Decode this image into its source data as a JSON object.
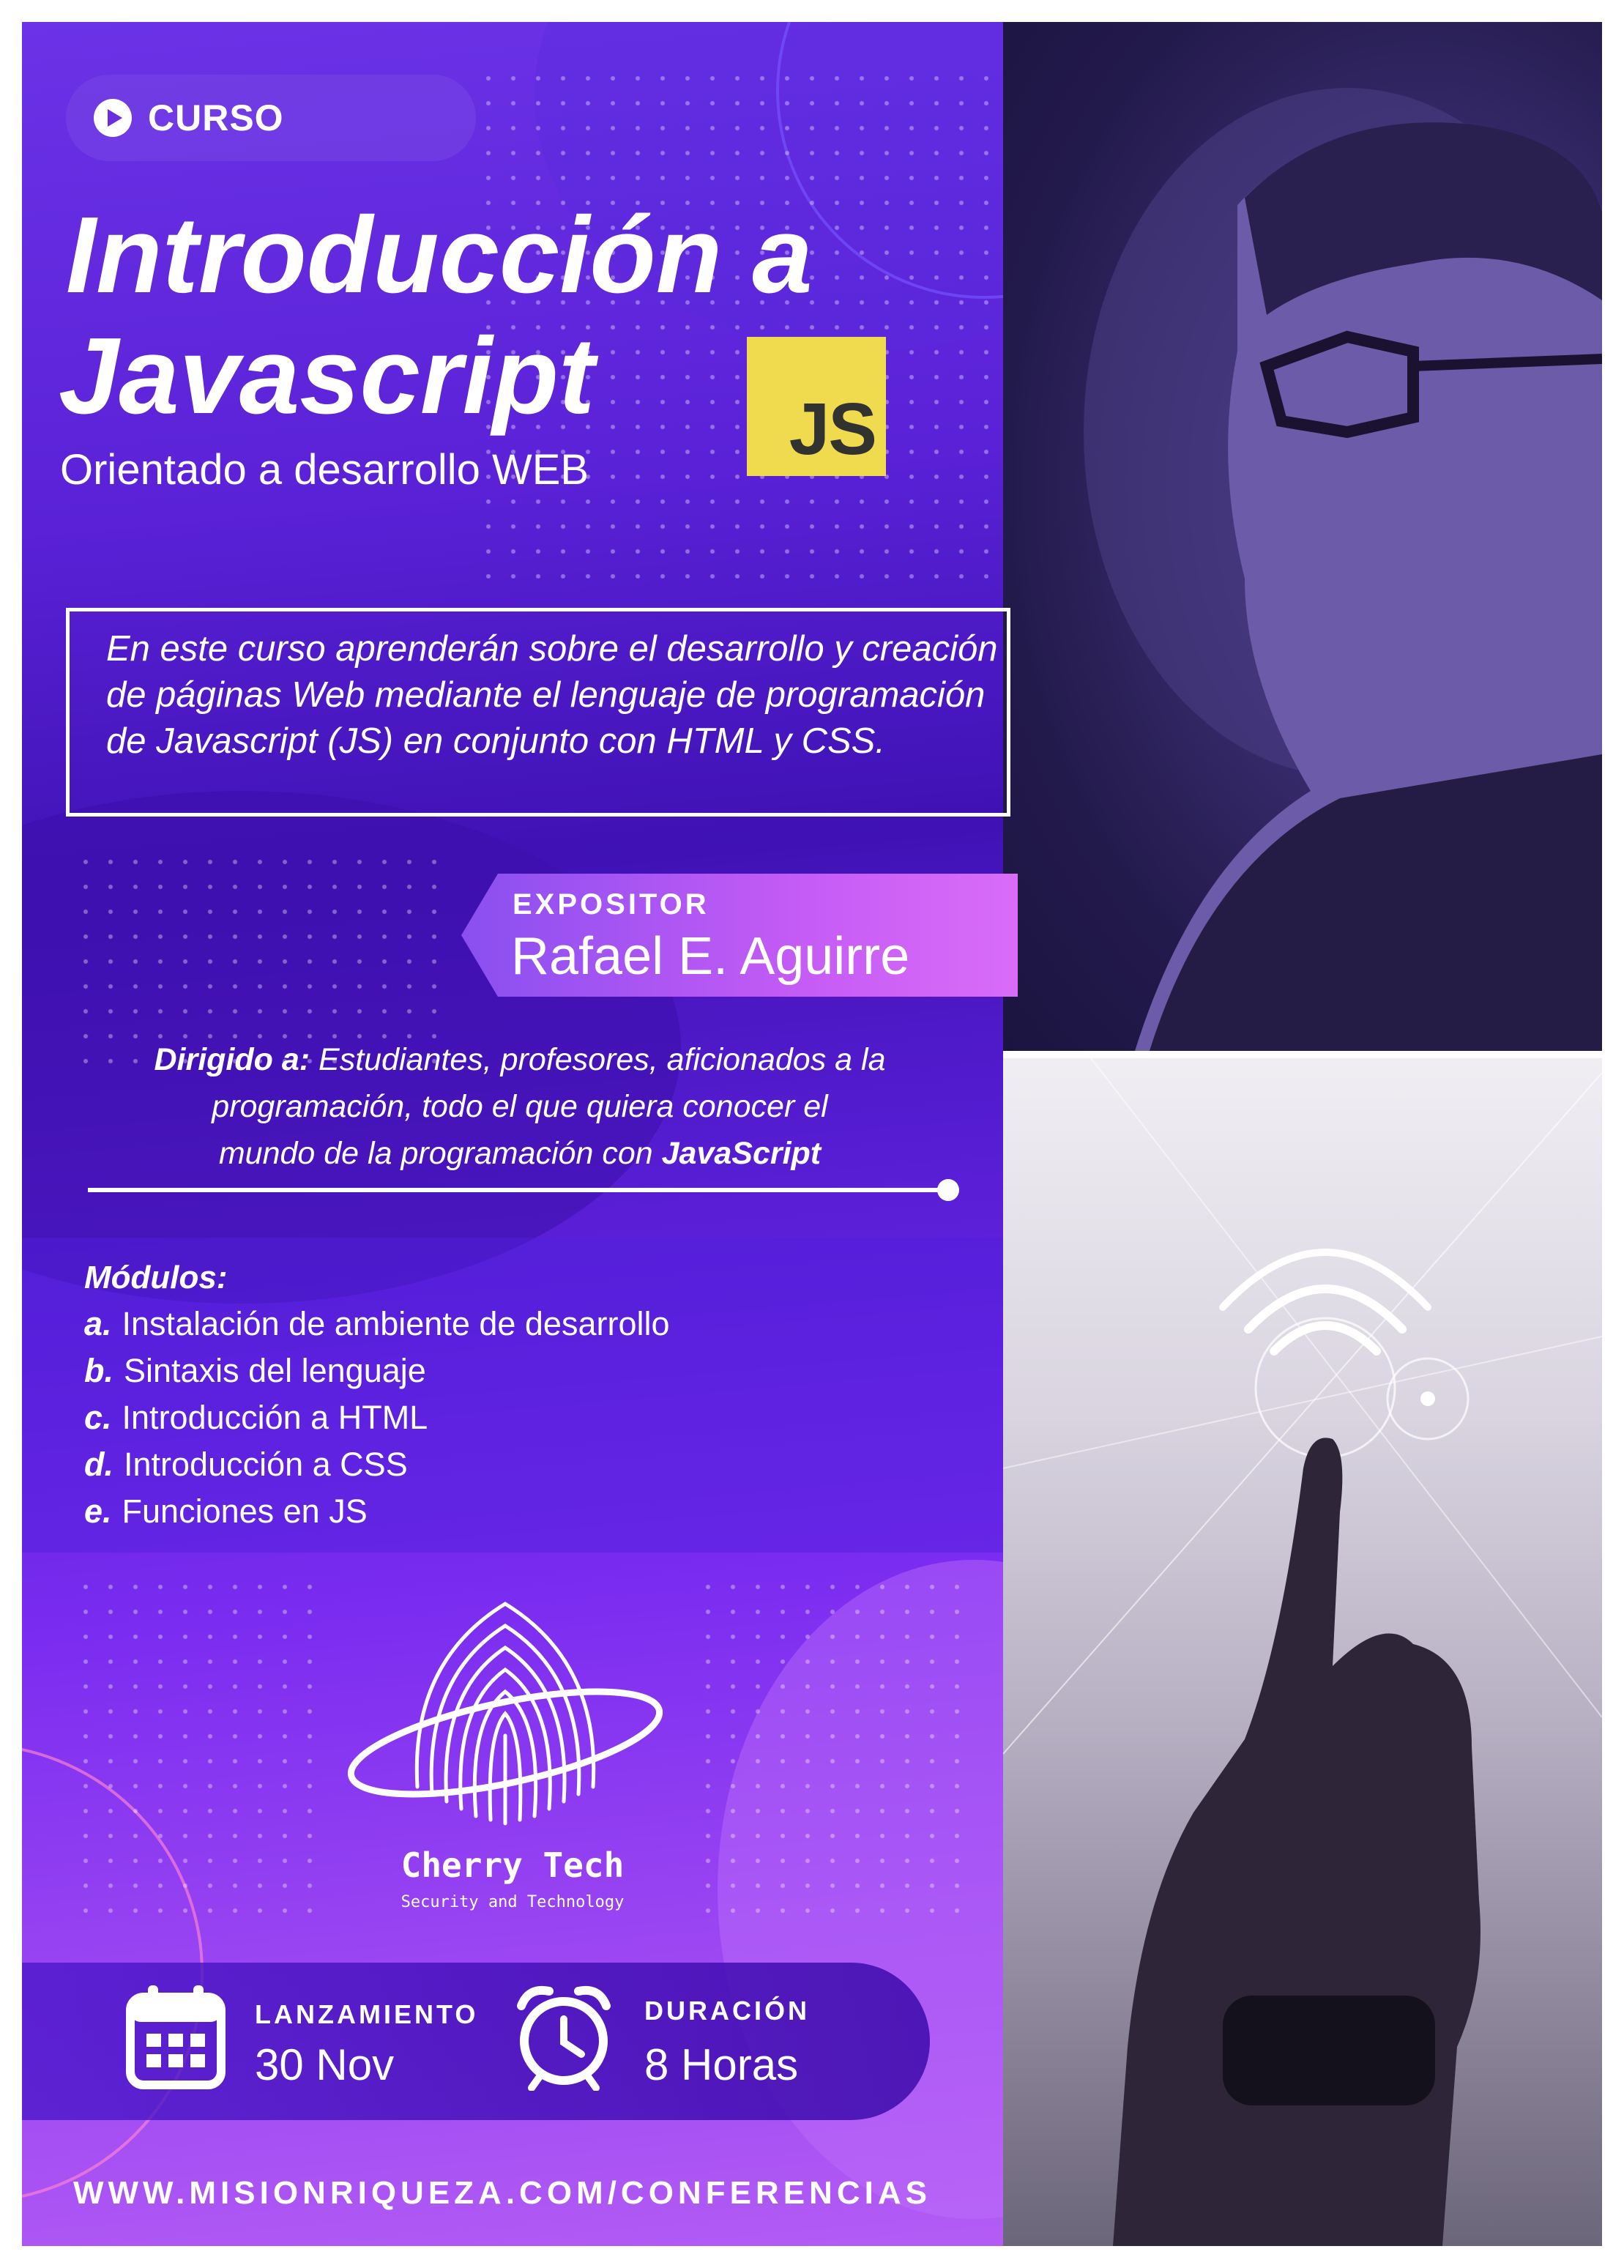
{
  "badge": {
    "label": "CURSO"
  },
  "title": {
    "line1": "Introducción a",
    "line2": "Javascript",
    "subtitle": "Orientado a desarrollo WEB",
    "js_logo": "JS"
  },
  "description": "En este curso aprenderán sobre el desarrollo y creación de páginas Web mediante el lenguaje de programación de Javascript (JS) en conjunto con HTML y CSS.",
  "expositor": {
    "label": "EXPOSITOR",
    "name": "Rafael E. Aguirre"
  },
  "audience": {
    "label": "Dirigido a:",
    "text_line1": " Estudiantes, profesores, aficionados a la",
    "text_line2": "programación, todo el que quiera conocer el",
    "text_line3": "mundo de la programación con ",
    "highlight": "JavaScript"
  },
  "modules": {
    "title": "Módulos:",
    "items": [
      {
        "letter": "a.",
        "text": "Instalación de ambiente de desarrollo"
      },
      {
        "letter": "b.",
        "text": "Sintaxis del lenguaje"
      },
      {
        "letter": "c.",
        "text": "Introducción a HTML"
      },
      {
        "letter": "d.",
        "text": "Introducción a CSS"
      },
      {
        "letter": "e.",
        "text": "Funciones en JS"
      }
    ]
  },
  "logo": {
    "name": "Cherry Tech",
    "tagline": "Security and Technology"
  },
  "launch": {
    "label": "LANZAMIENTO",
    "value": "30 Nov"
  },
  "duration": {
    "label": "DURACIÓN",
    "value": "8 Horas"
  },
  "url": "WWW.MISIONRIQUEZA.COM/CONFERENCIAS",
  "colors": {
    "purple_dark": "#3f12b5",
    "purple": "#6b32e6",
    "magenta": "#c45bf5",
    "js_yellow": "#f0db4f"
  }
}
